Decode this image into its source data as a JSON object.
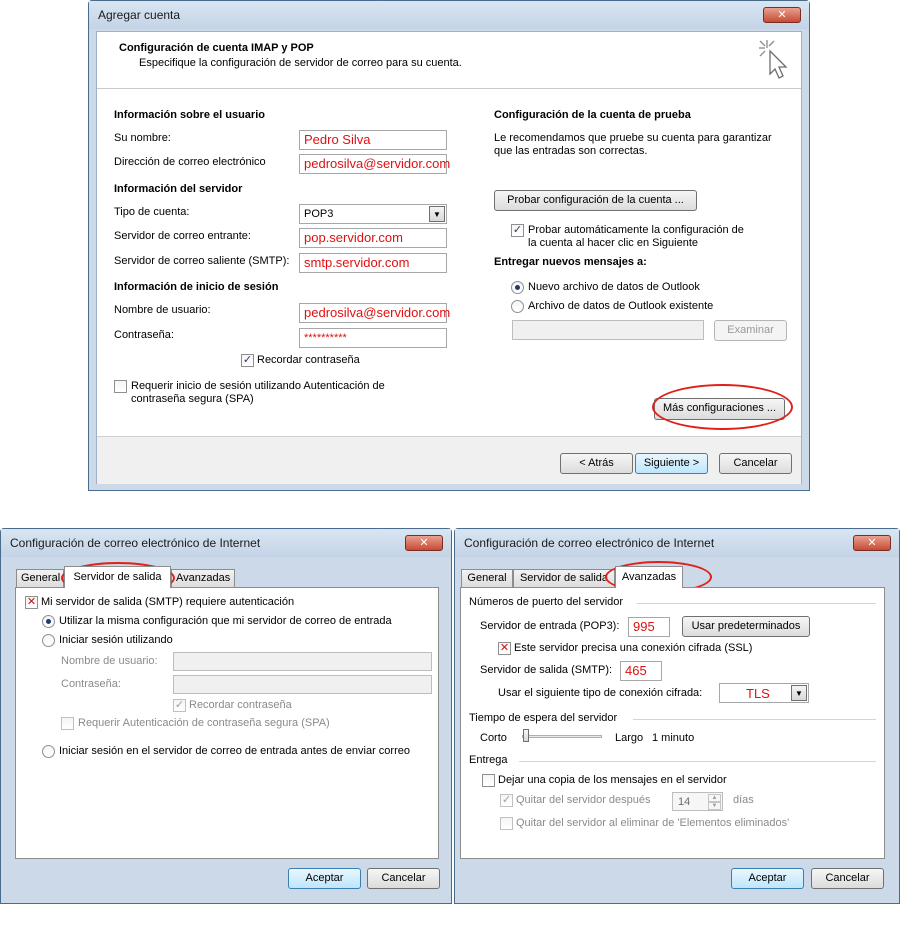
{
  "window_add": {
    "title": "Agregar cuenta",
    "header_title": "Configuración de cuenta IMAP y POP",
    "header_subtitle": "Especifique la configuración de servidor de correo para su cuenta.",
    "user_info_heading": "Información sobre el usuario",
    "name_label": "Su nombre:",
    "name_value": "Pedro Silva",
    "email_label": "Dirección de correo electrónico",
    "email_value": "pedrosilva@servidor.com",
    "server_info_heading": "Información del servidor",
    "account_type_label": "Tipo de cuenta:",
    "account_type_value": "POP3",
    "incoming_label": "Servidor de correo entrante:",
    "incoming_value": "pop.servidor.com",
    "outgoing_label": "Servidor de correo saliente (SMTP):",
    "outgoing_value": "smtp.servidor.com",
    "logon_heading": "Información de inicio de sesión",
    "username_label": "Nombre de usuario:",
    "username_value": "pedrosilva@servidor.com",
    "password_label": "Contraseña:",
    "password_value": "**********",
    "remember_password": "Recordar contraseña",
    "spa_line1": "Requerir inicio de sesión utilizando Autenticación de",
    "spa_line2": "contraseña segura (SPA)",
    "test_heading": "Configuración de la cuenta de prueba",
    "test_desc_line1": "Le recomendamos que pruebe su cuenta para garantizar",
    "test_desc_line2": "que las entradas son correctas.",
    "test_button": "Probar configuración de la cuenta ...",
    "auto_test_line1": "Probar automáticamente la configuración de",
    "auto_test_line2": "la cuenta al hacer clic en Siguiente",
    "deliver_heading": "Entregar nuevos mensajes a:",
    "new_data_file": "Nuevo archivo de datos de Outlook",
    "existing_data_file": "Archivo de datos de Outlook existente",
    "browse_button": "Examinar",
    "more_settings_button": "Más configuraciones ...",
    "back_button": "< Atrás",
    "next_button": "Siguiente >",
    "cancel_button": "Cancelar"
  },
  "window_outgoing": {
    "title": "Configuración de correo electrónico de Internet",
    "tabs": [
      "General",
      "Servidor de salida",
      "Avanzadas"
    ],
    "smtp_auth": "Mi servidor de salida (SMTP) requiere autenticación",
    "same_settings": "Utilizar la misma configuración que mi servidor de correo de entrada",
    "logon_using": "Iniciar sesión utilizando",
    "username_label": "Nombre de usuario:",
    "password_label": "Contraseña:",
    "remember_password": "Recordar contraseña",
    "spa": "Requerir Autenticación de contraseña segura (SPA)",
    "logon_before": "Iniciar sesión en el servidor de correo de entrada antes de enviar correo",
    "ok_button": "Aceptar",
    "cancel_button": "Cancelar"
  },
  "window_advanced": {
    "title": "Configuración de correo electrónico de Internet",
    "tabs": [
      "General",
      "Servidor de salida",
      "Avanzadas"
    ],
    "ports_heading": "Números de puerto del servidor",
    "incoming_label": "Servidor de entrada (POP3):",
    "incoming_port": "995",
    "defaults_button": "Usar predeterminados",
    "ssl_label": "Este servidor precisa una conexión cifrada (SSL)",
    "outgoing_label": "Servidor de salida (SMTP):",
    "outgoing_port": "465",
    "encryption_label": "Usar el siguiente tipo de conexión cifrada:",
    "encryption_value": "TLS",
    "timeout_heading": "Tiempo de espera del servidor",
    "timeout_short": "Corto",
    "timeout_long": "Largo",
    "timeout_value": "1 minuto",
    "timeout_level": 0.02,
    "delivery_heading": "Entrega",
    "leave_copy": "Dejar una copia de los mensajes en el servidor",
    "remove_after": "Quitar del servidor después",
    "remove_days": "14",
    "days_label": "días",
    "remove_deleted": "Quitar del servidor al eliminar de 'Elementos eliminados'",
    "ok_button": "Aceptar",
    "cancel_button": "Cancelar"
  },
  "colors": {
    "highlight_red": "#e0201a",
    "window_frame": "#cbd9e8"
  }
}
